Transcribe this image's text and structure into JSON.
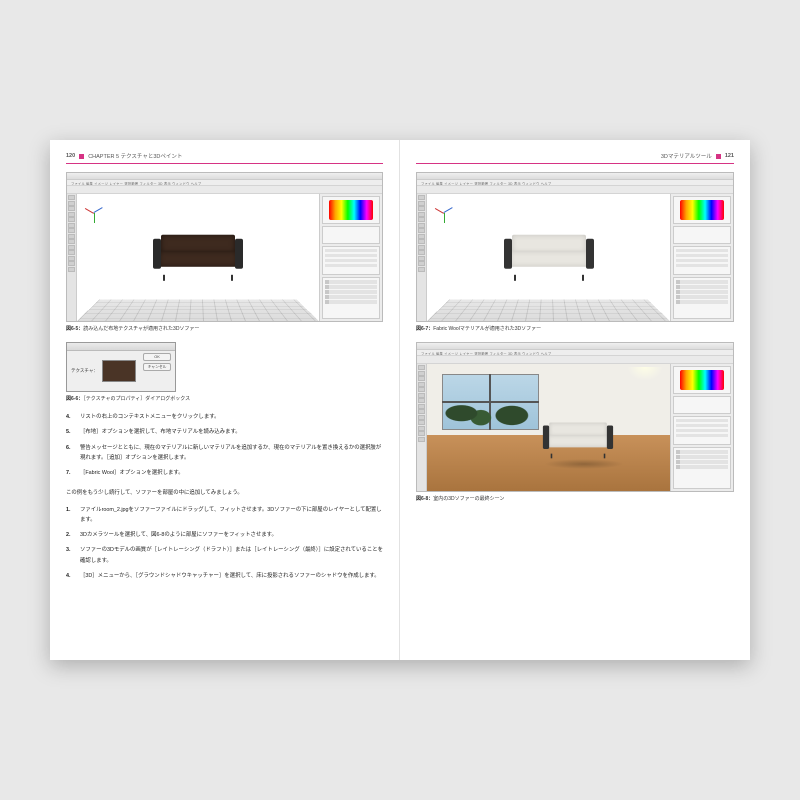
{
  "left": {
    "page_number": "120",
    "chapter": "CHAPTER 5  テクスチャと3Dペイント",
    "fig65_caption_label": "図6-5：",
    "fig65_caption": "読み込んだ布地テクスチャが適用された3Dソファー",
    "menubar": "ファイル 編集 イメージ レイヤー 選択範囲 フィルター 3D 表示 ウィンドウ ヘルプ",
    "dialog_label": "テクスチャ：",
    "dialog_ok": "OK",
    "dialog_cancel": "キャンセル",
    "fig66_caption_label": "図6-6：",
    "fig66_caption": "［テクスチャのプロパティ］ダイアログボックス",
    "listA": {
      "4": "リストの右上のコンテキストメニューをクリックします。",
      "5": "［布地］オプションを選択して、布地マテリアルを読み込みます。",
      "6": "警告メッセージとともに、現在のマテリアルに新しいマテリアルを追加するか、現在のマテリアルを置き換えるかの選択肢が現れます。［追加］オプションを選択します。",
      "7": "［Fabric Wool］オプションを選択します。"
    },
    "paragraph": "この例をもう少し続行して、ソファーを部屋の中に追加してみましょう。",
    "listB": {
      "1": "ファイルroom_2.jpgをソファーファイルにドラッグして、フィットさせます。3Dソファーの下に部屋のレイヤーとして配置します。",
      "2": "3Dカメラツールを選択して、図6-8のように部屋にソファーをフィットさせます。",
      "3": "ソファーの3Dモデルの画質が［レイトレーシング（ドラフト）］または［レイトレーシング（最終）］に設定されていることを確認します。",
      "4": "［3D］メニューから、［グラウンドシャドウキャッチャー］を選択して、床に投影されるソファーのシャドウを作成します。"
    }
  },
  "right": {
    "page_number": "121",
    "running_head": "3Dマテリアルツール",
    "menubar": "ファイル 編集 イメージ レイヤー 選択範囲 フィルター 3D 表示 ウィンドウ ヘルプ",
    "fig67_caption_label": "図6-7：",
    "fig67_caption": "Fabric Woolマテリアルが適用された3Dソファー",
    "fig68_caption_label": "図6-8：",
    "fig68_caption": "室内の3Dソファーの最終シーン"
  }
}
